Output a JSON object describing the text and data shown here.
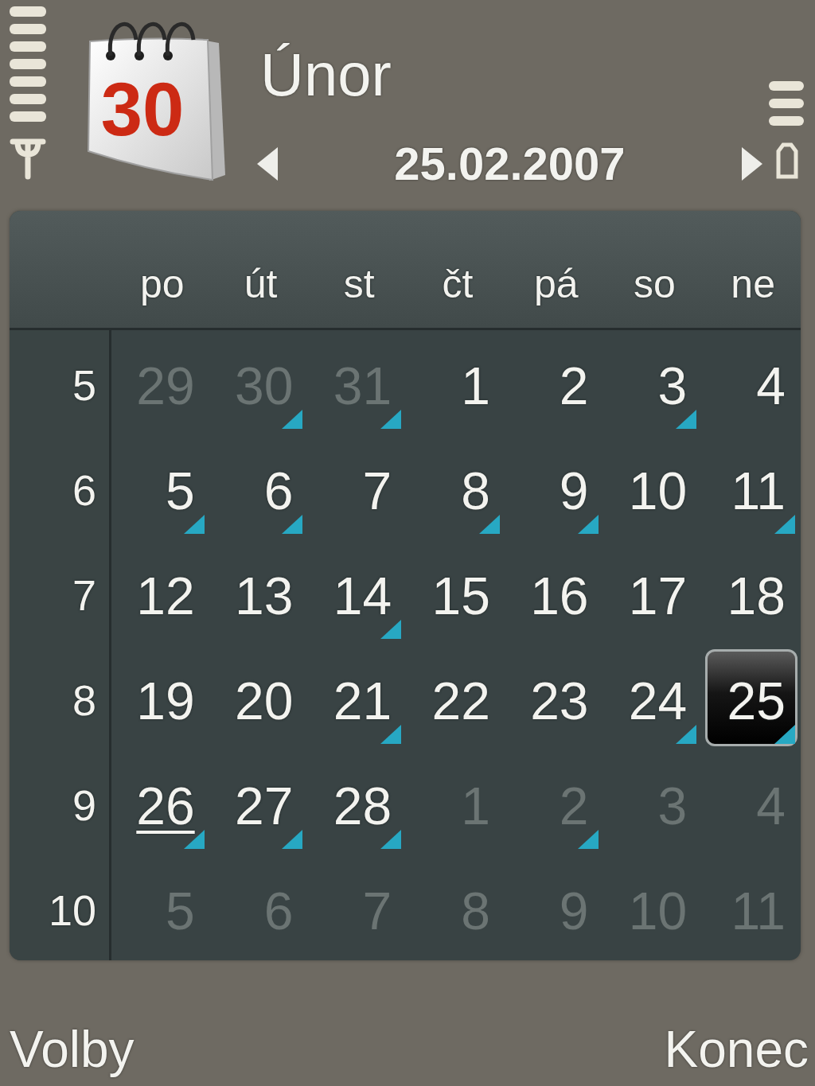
{
  "app_icon": {
    "day": "30"
  },
  "header": {
    "title": "Únor",
    "date": "25.02.2007"
  },
  "calendar": {
    "weekdays": [
      "po",
      "út",
      "st",
      "čt",
      "pá",
      "so",
      "ne"
    ],
    "weeks": [
      {
        "number": "5",
        "days": [
          {
            "label": "29",
            "other_month": true,
            "has_event": false,
            "selected": false,
            "today": false
          },
          {
            "label": "30",
            "other_month": true,
            "has_event": true,
            "selected": false,
            "today": false
          },
          {
            "label": "31",
            "other_month": true,
            "has_event": true,
            "selected": false,
            "today": false
          },
          {
            "label": "1",
            "other_month": false,
            "has_event": false,
            "selected": false,
            "today": false
          },
          {
            "label": "2",
            "other_month": false,
            "has_event": false,
            "selected": false,
            "today": false
          },
          {
            "label": "3",
            "other_month": false,
            "has_event": true,
            "selected": false,
            "today": false
          },
          {
            "label": "4",
            "other_month": false,
            "has_event": false,
            "selected": false,
            "today": false
          }
        ]
      },
      {
        "number": "6",
        "days": [
          {
            "label": "5",
            "other_month": false,
            "has_event": true,
            "selected": false,
            "today": false
          },
          {
            "label": "6",
            "other_month": false,
            "has_event": true,
            "selected": false,
            "today": false
          },
          {
            "label": "7",
            "other_month": false,
            "has_event": false,
            "selected": false,
            "today": false
          },
          {
            "label": "8",
            "other_month": false,
            "has_event": true,
            "selected": false,
            "today": false
          },
          {
            "label": "9",
            "other_month": false,
            "has_event": true,
            "selected": false,
            "today": false
          },
          {
            "label": "10",
            "other_month": false,
            "has_event": false,
            "selected": false,
            "today": false
          },
          {
            "label": "11",
            "other_month": false,
            "has_event": true,
            "selected": false,
            "today": false
          }
        ]
      },
      {
        "number": "7",
        "days": [
          {
            "label": "12",
            "other_month": false,
            "has_event": false,
            "selected": false,
            "today": false
          },
          {
            "label": "13",
            "other_month": false,
            "has_event": false,
            "selected": false,
            "today": false
          },
          {
            "label": "14",
            "other_month": false,
            "has_event": true,
            "selected": false,
            "today": false
          },
          {
            "label": "15",
            "other_month": false,
            "has_event": false,
            "selected": false,
            "today": false
          },
          {
            "label": "16",
            "other_month": false,
            "has_event": false,
            "selected": false,
            "today": false
          },
          {
            "label": "17",
            "other_month": false,
            "has_event": false,
            "selected": false,
            "today": false
          },
          {
            "label": "18",
            "other_month": false,
            "has_event": false,
            "selected": false,
            "today": false
          }
        ]
      },
      {
        "number": "8",
        "days": [
          {
            "label": "19",
            "other_month": false,
            "has_event": false,
            "selected": false,
            "today": false
          },
          {
            "label": "20",
            "other_month": false,
            "has_event": false,
            "selected": false,
            "today": false
          },
          {
            "label": "21",
            "other_month": false,
            "has_event": true,
            "selected": false,
            "today": false
          },
          {
            "label": "22",
            "other_month": false,
            "has_event": false,
            "selected": false,
            "today": false
          },
          {
            "label": "23",
            "other_month": false,
            "has_event": false,
            "selected": false,
            "today": false
          },
          {
            "label": "24",
            "other_month": false,
            "has_event": true,
            "selected": false,
            "today": false
          },
          {
            "label": "25",
            "other_month": false,
            "has_event": true,
            "selected": true,
            "today": false
          }
        ]
      },
      {
        "number": "9",
        "days": [
          {
            "label": "26",
            "other_month": false,
            "has_event": true,
            "selected": false,
            "today": true
          },
          {
            "label": "27",
            "other_month": false,
            "has_event": true,
            "selected": false,
            "today": false
          },
          {
            "label": "28",
            "other_month": false,
            "has_event": true,
            "selected": false,
            "today": false
          },
          {
            "label": "1",
            "other_month": true,
            "has_event": false,
            "selected": false,
            "today": false
          },
          {
            "label": "2",
            "other_month": true,
            "has_event": true,
            "selected": false,
            "today": false
          },
          {
            "label": "3",
            "other_month": true,
            "has_event": false,
            "selected": false,
            "today": false
          },
          {
            "label": "4",
            "other_month": true,
            "has_event": false,
            "selected": false,
            "today": false
          }
        ]
      },
      {
        "number": "10",
        "days": [
          {
            "label": "5",
            "other_month": true,
            "has_event": false,
            "selected": false,
            "today": false
          },
          {
            "label": "6",
            "other_month": true,
            "has_event": false,
            "selected": false,
            "today": false
          },
          {
            "label": "7",
            "other_month": true,
            "has_event": false,
            "selected": false,
            "today": false
          },
          {
            "label": "8",
            "other_month": true,
            "has_event": false,
            "selected": false,
            "today": false
          },
          {
            "label": "9",
            "other_month": true,
            "has_event": false,
            "selected": false,
            "today": false
          },
          {
            "label": "10",
            "other_month": true,
            "has_event": false,
            "selected": false,
            "today": false
          },
          {
            "label": "11",
            "other_month": true,
            "has_event": false,
            "selected": false,
            "today": false
          }
        ]
      }
    ]
  },
  "softkeys": {
    "left": "Volby",
    "right": "Konec"
  }
}
